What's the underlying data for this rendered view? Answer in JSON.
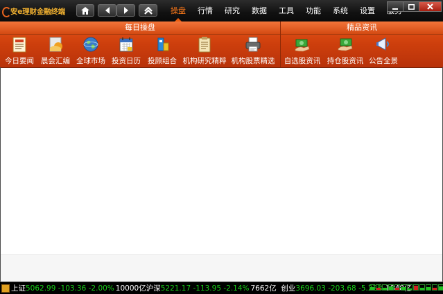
{
  "app": {
    "title": "安e理财金融终端"
  },
  "nav_buttons": [
    {
      "name": "home-icon"
    },
    {
      "name": "back-icon"
    },
    {
      "name": "forward-icon"
    },
    {
      "name": "collapse-up-icon"
    }
  ],
  "menu": {
    "items": [
      "操盘",
      "行情",
      "研究",
      "数据",
      "工具",
      "功能",
      "系统",
      "设置",
      "服务"
    ],
    "active": "操盘"
  },
  "window_controls": [
    "minimize",
    "maximize",
    "close"
  ],
  "panel": {
    "daily_section": "每日操盘",
    "premium_section": "精品资讯",
    "tools": [
      {
        "label": "今日要闻",
        "icon": "newspaper-icon"
      },
      {
        "label": "晨会汇编",
        "icon": "meeting-report-icon"
      },
      {
        "label": "全球市场",
        "icon": "globe-icon"
      },
      {
        "label": "投资日历",
        "icon": "calendar-icon"
      },
      {
        "label": "投顾组合",
        "icon": "portfolio-icon"
      },
      {
        "label": "机构研究精粹",
        "icon": "clipboard-icon"
      },
      {
        "label": "机构股票精选",
        "icon": "printer-icon"
      },
      {
        "label": "自选股资讯",
        "icon": "handshake-icon"
      },
      {
        "label": "持仓股资讯",
        "icon": "holding-icon"
      },
      {
        "label": "公告全景",
        "icon": "announcement-icon"
      }
    ]
  },
  "status": {
    "indices": [
      {
        "name": "上证",
        "value": "5062.99",
        "change": "-103.36",
        "pct": "-2.00%",
        "volume": "10000亿"
      },
      {
        "name": "沪深",
        "value": "5221.17",
        "change": "-113.95",
        "pct": "-2.14%",
        "volume": "7662亿"
      },
      {
        "name": "创业",
        "value": "3696.03",
        "change": "-203.68",
        "pct": "-5.22%",
        "volume": "1848亿"
      }
    ],
    "mini_bars": [
      0.6,
      0.5,
      0.4,
      0.7,
      0.5,
      0.6,
      0.3,
      0.8,
      0.5,
      0.6,
      0.4,
      0.7
    ],
    "colors": {
      "up": "#d02020",
      "down": "#18d018",
      "accent": "#e8571b"
    }
  }
}
